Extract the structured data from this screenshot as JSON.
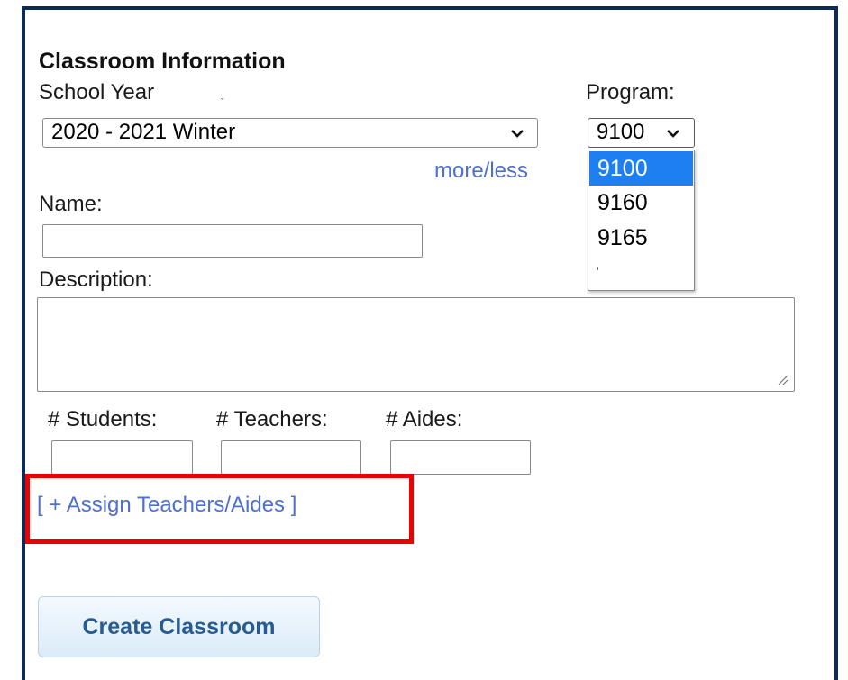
{
  "form": {
    "section_title": "Classroom Information",
    "school_year": {
      "label": "School Year",
      "selected": "2020 - 2021 Winter"
    },
    "program": {
      "label": "Program:",
      "selected": "9100",
      "options": [
        "9100",
        "9160",
        "9165"
      ]
    },
    "more_less_link": "more/less",
    "name": {
      "label": "Name:",
      "value": ""
    },
    "description": {
      "label": "Description:",
      "value": ""
    },
    "counts": {
      "students_label": "# Students:",
      "teachers_label": "# Teachers:",
      "aides_label": "# Aides:",
      "students_value": "",
      "teachers_value": "",
      "aides_value": ""
    },
    "assign_link": "[ + Assign Teachers/Aides ]",
    "create_button": "Create Classroom"
  },
  "colors": {
    "frame": "#0d2a57",
    "link": "#4f6fd0",
    "highlight": "#ee0000",
    "dropdown_selected": "#1d7ff1",
    "button_text": "#275b91"
  },
  "icons": {
    "select_arrow": "chevron-down-icon",
    "resize_grip": "resize-grip-icon"
  }
}
